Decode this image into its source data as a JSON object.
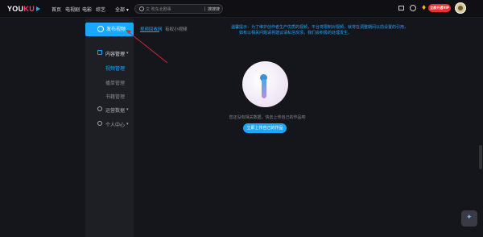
{
  "header": {
    "logo": "YOUKU",
    "nav": [
      "首页",
      "电视剧",
      "电影",
      "综艺"
    ],
    "category": "全部",
    "search_placeholder": "文 吹东北剧事",
    "search_button": "搜搜搜",
    "vip_label": "立即开通VIP"
  },
  "sidebar": {
    "publish_label": "发布视频",
    "items": [
      {
        "label": "内容管理",
        "icon": "content-icon"
      },
      {
        "label": "视频管理"
      },
      {
        "label": "播单管理"
      },
      {
        "label": "书籍管理"
      },
      {
        "label": "运营数据",
        "icon": "data-icon"
      },
      {
        "label": "个人中心",
        "icon": "user-icon"
      }
    ]
  },
  "tabs": [
    "视频回收网",
    "有权小视频"
  ],
  "notice": [
    "温馨提示：为了维护创作者生产优质的视频，平台将限制对视频，就将在调整期间以前设置的引用，",
    "如有以相关问题请将建议请私信反馈，我们会积极的处理发生。"
  ],
  "empty": {
    "text": "您还没有相关数据，快去上传自己的作品吧",
    "cta": "立即上传自己的作品"
  },
  "colors": {
    "accent": "#1aa8ff",
    "background": "#15151c",
    "sidebar": "#1e1e25",
    "vip": "#e6312f",
    "arrow": "#d02a2a"
  }
}
